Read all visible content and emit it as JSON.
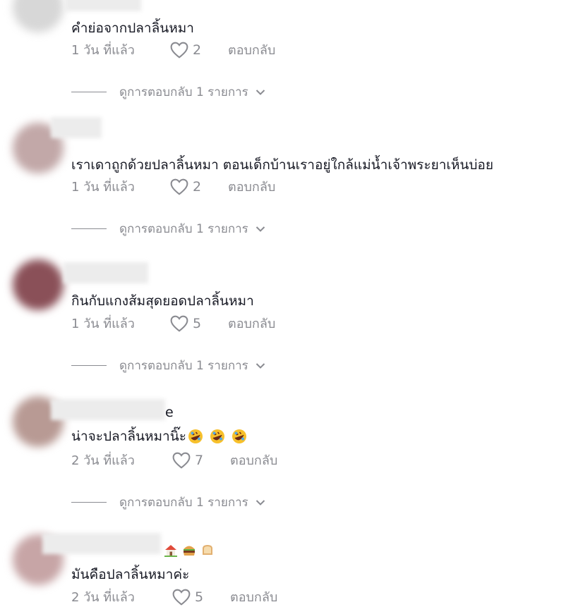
{
  "comments": [
    {
      "name_suffix": "",
      "text": "คำย่อจากปลาลิ้นหมา",
      "time": "1 วัน ที่แล้ว",
      "likes": "2",
      "reply_label": "ตอบกลับ",
      "view_replies": "ดูการตอบกลับ 1 รายการ"
    },
    {
      "name_suffix": "",
      "text": "เราเดาถูกด้วยปลาลิ้นหมา ตอนเด็กบ้านเราอยู่ใกล้แม่น้ำเจ้าพระยาเห็นบ่อย",
      "time": "1 วัน ที่แล้ว",
      "likes": "2",
      "reply_label": "ตอบกลับ",
      "view_replies": "ดูการตอบกลับ 1 รายการ"
    },
    {
      "name_suffix": "",
      "text": "กินกับแกงส้มสุดยอดปลาลิ้นหมา",
      "time": "1 วัน ที่แล้ว",
      "likes": "5",
      "reply_label": "ตอบกลับ",
      "view_replies": "ดูการตอบกลับ 1 รายการ"
    },
    {
      "name_suffix": "e",
      "text": "น่าจะปลาลิ้นหมานิ๊ะ",
      "time": "2 วัน ที่แล้ว",
      "likes": "7",
      "reply_label": "ตอบกลับ",
      "view_replies": "ดูการตอบกลับ 1 รายการ"
    },
    {
      "name_suffix": "",
      "text": "มันคือปลาลิ้นหมาค่ะ",
      "time": "2 วัน ที่แล้ว",
      "likes": "5",
      "reply_label": "ตอบกลับ",
      "view_replies": ""
    }
  ],
  "icons": {
    "like": "heart-outline-icon",
    "expand": "chevron-down-icon",
    "text_emoji_comment_4": [
      "rolling-on-floor-laughing-icon",
      "rolling-on-floor-laughing-icon",
      "rolling-on-floor-laughing-icon"
    ],
    "name_emoji_comment_5": [
      "house-icon",
      "hamburger-icon",
      "bread-icon"
    ]
  },
  "colors": {
    "text": "#161823",
    "secondary": "#8a8b91",
    "background": "#ffffff"
  }
}
